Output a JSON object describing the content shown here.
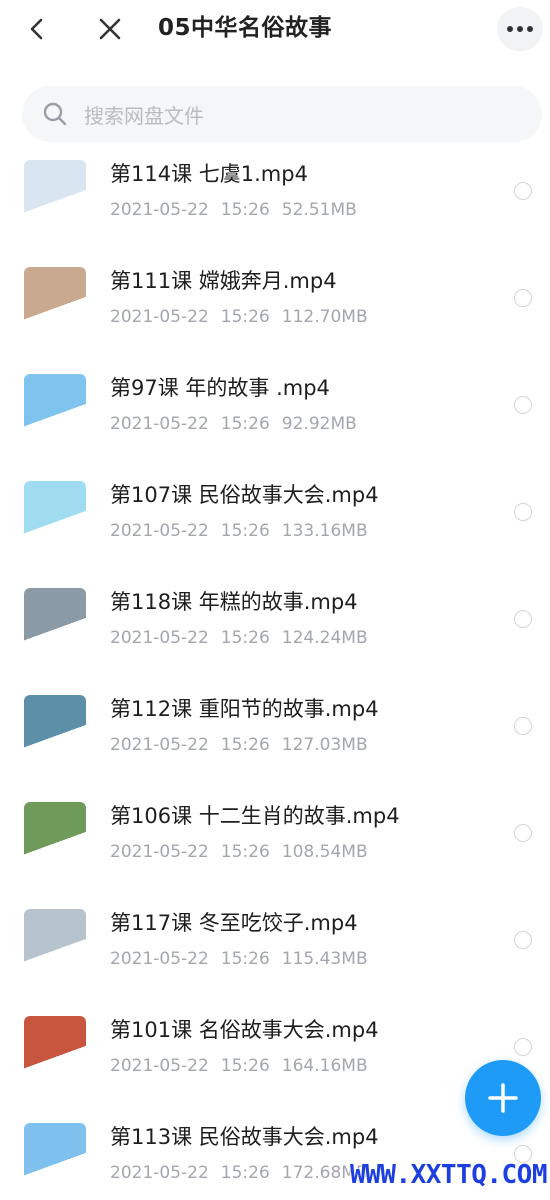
{
  "header": {
    "title": "05中华名俗故事"
  },
  "search": {
    "placeholder": "搜索网盘文件"
  },
  "files": [
    {
      "name": "第114课 七虞1.mp4",
      "date": "2021-05-22",
      "time": "15:26",
      "size": "52.51MB"
    },
    {
      "name": "第111课 嫦娥奔月.mp4",
      "date": "2021-05-22",
      "time": "15:26",
      "size": "112.70MB"
    },
    {
      "name": "第97课 年的故事 .mp4",
      "date": "2021-05-22",
      "time": "15:26",
      "size": "92.92MB"
    },
    {
      "name": "第107课 民俗故事大会.mp4",
      "date": "2021-05-22",
      "time": "15:26",
      "size": "133.16MB"
    },
    {
      "name": "第118课 年糕的故事.mp4",
      "date": "2021-05-22",
      "time": "15:26",
      "size": "124.24MB"
    },
    {
      "name": "第112课 重阳节的故事.mp4",
      "date": "2021-05-22",
      "time": "15:26",
      "size": "127.03MB"
    },
    {
      "name": "第106课 十二生肖的故事.mp4",
      "date": "2021-05-22",
      "time": "15:26",
      "size": "108.54MB"
    },
    {
      "name": "第117课 冬至吃饺子.mp4",
      "date": "2021-05-22",
      "time": "15:26",
      "size": "115.43MB"
    },
    {
      "name": "第101课 名俗故事大会.mp4",
      "date": "2021-05-22",
      "time": "15:26",
      "size": "164.16MB"
    },
    {
      "name": "第113课 民俗故事大会.mp4",
      "date": "2021-05-22",
      "time": "15:26",
      "size": "172.68MB"
    }
  ],
  "thumb_colors": [
    "#d9e6f2",
    "#c9a98f",
    "#7fc3ef",
    "#9fdcef",
    "#8a9aa6",
    "#5d8fa8",
    "#6e9a5a",
    "#b7c3cc",
    "#c8563f",
    "#7ec1ee"
  ],
  "watermark": "WWW.XXTTQ.COM",
  "accent_color": "#1e9bf7"
}
